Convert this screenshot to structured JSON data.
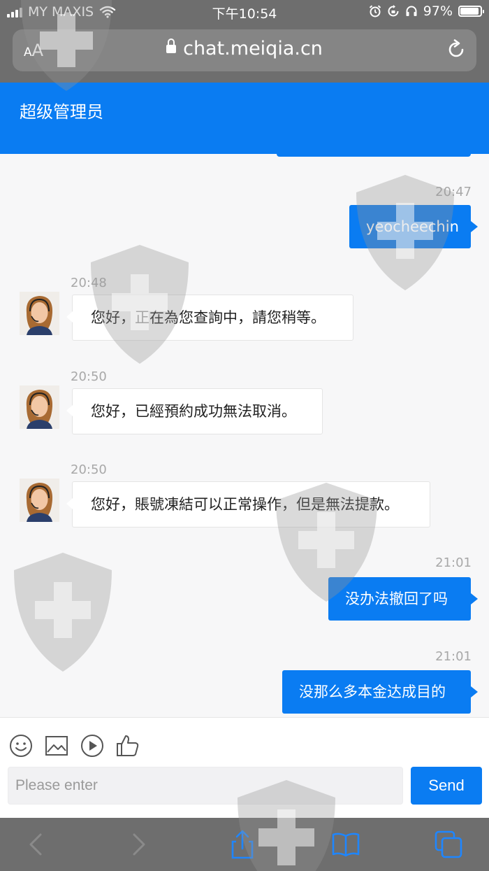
{
  "status_bar": {
    "carrier": "MY MAXIS",
    "time": "下午10:54",
    "battery": "97%",
    "battery_level": 0.97
  },
  "url_bar": {
    "text_size_label_small": "A",
    "text_size_label_large": "A",
    "url": "chat.meiqia.cn"
  },
  "header": {
    "title": "超级管理员"
  },
  "messages": [
    {
      "time": "20:47",
      "direction": "out",
      "text": "yeocheechin"
    },
    {
      "time": "20:48",
      "direction": "in",
      "text": "您好，正在為您查詢中，請您稍等。"
    },
    {
      "time": "20:50",
      "direction": "in",
      "text": "您好，已經預約成功無法取消。"
    },
    {
      "time": "20:50",
      "direction": "in",
      "text": "您好，賬號凍結可以正常操作，但是無法提款。"
    },
    {
      "time": "21:01",
      "direction": "out",
      "text": "没办法撤回了吗"
    },
    {
      "time": "21:01",
      "direction": "out",
      "text": "没那么多本金达成目的"
    }
  ],
  "composer": {
    "placeholder": "Please enter",
    "value": "",
    "send_label": "Send",
    "tools": [
      "emoji-icon",
      "image-icon",
      "play-icon",
      "thumbs-up-icon"
    ]
  },
  "bottom_bar": {
    "icons": [
      "back-icon",
      "forward-icon",
      "share-icon",
      "bookmarks-icon",
      "tabs-icon"
    ]
  },
  "colors": {
    "accent": "#0a7cf2",
    "chrome": "#6e6e6e",
    "chat_bg": "#f7f7f8",
    "timestamp": "#a8a8a8"
  }
}
